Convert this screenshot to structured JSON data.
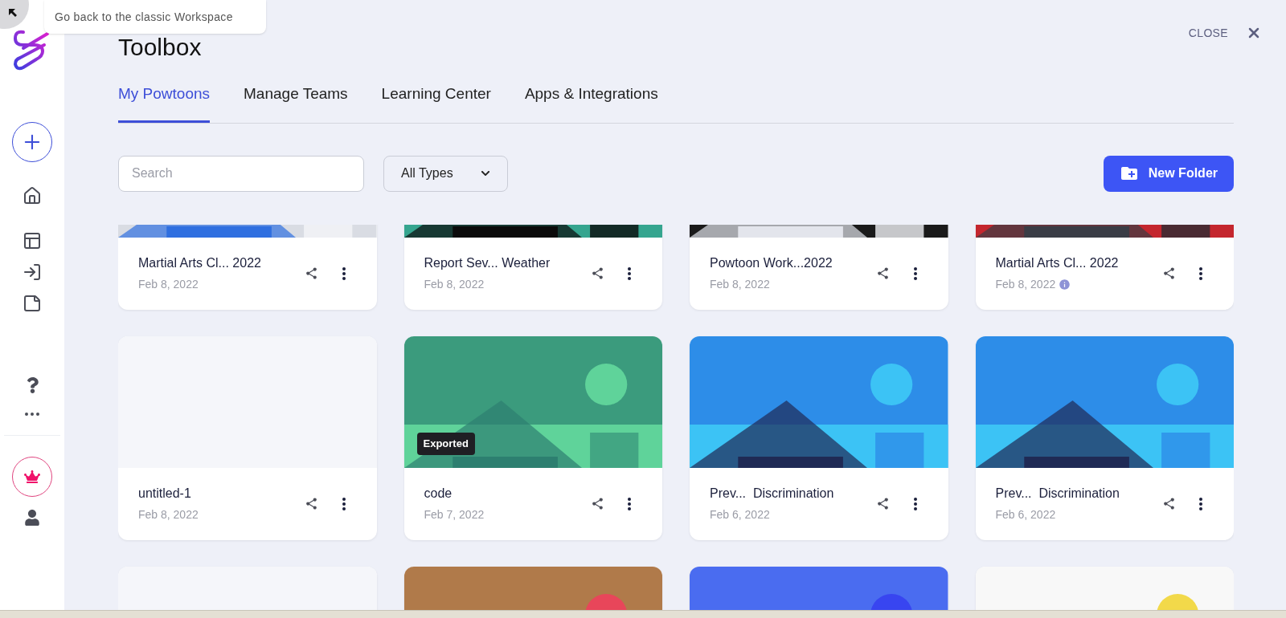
{
  "tooltip": {
    "text": "Go back to the classic Workspace"
  },
  "header": {
    "title": "Toolbox",
    "close": "CLOSE"
  },
  "tabs": [
    {
      "label": "My Powtoons",
      "selected": true
    },
    {
      "label": "Manage Teams",
      "selected": false
    },
    {
      "label": "Learning Center",
      "selected": false
    },
    {
      "label": "Apps & Integrations",
      "selected": false
    }
  ],
  "search": {
    "placeholder": "Search"
  },
  "type_filter": {
    "value": "All Types"
  },
  "new_folder": {
    "label": "New Folder"
  },
  "cards": [
    {
      "kind": "picture",
      "title": "Martial Arts Cl... 2022",
      "date": "Feb 8, 2022",
      "info": false
    },
    {
      "kind": "picture",
      "title": "Report Sev... Weather",
      "date": "Feb 8, 2022",
      "info": false
    },
    {
      "kind": "picture",
      "title": "Powtoon Work...2022",
      "date": "Feb 8, 2022",
      "info": false
    },
    {
      "kind": "picture",
      "title": "Martial Arts Cl... 2022",
      "date": "Feb 8, 2022",
      "info": true
    },
    {
      "kind": "blank",
      "title": "untitled-1",
      "date": "Feb 8, 2022",
      "info": false
    },
    {
      "kind": "picture",
      "badge": "Exported",
      "title": "code",
      "date": "Feb 7, 2022",
      "info": false
    },
    {
      "kind": "picture",
      "title": "Prev...  Discrimination",
      "date": "Feb 6, 2022",
      "info": false
    },
    {
      "kind": "picture",
      "title": "Prev...  Discrimination",
      "date": "Feb 6, 2022",
      "info": false
    },
    {
      "kind": "blank"
    },
    {
      "kind": "picture"
    },
    {
      "kind": "picture"
    },
    {
      "kind": "picture"
    }
  ]
}
